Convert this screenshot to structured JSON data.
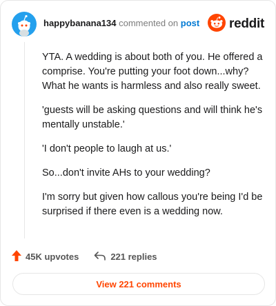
{
  "header": {
    "username": "happybanana134",
    "commented_text": "commented on",
    "post_link": "post",
    "logo_text": "reddit",
    "avatar_icon": "snoo-avatar-icon",
    "logo_icon": "reddit-alien-icon"
  },
  "comment": {
    "paragraphs": [
      "YTA. A wedding is about both of you. He offered a comprise. You're putting your foot down...why? What he wants is harmless and also really sweet.",
      "'guests will be asking questions and will think he's mentally unstable.'",
      "'I don't people to laugh at us.'",
      "So...don't invite AHs to your wedding?",
      "I'm sorry but given how callous you're being I'd be surprised if there even is a wedding now."
    ]
  },
  "actions": {
    "upvotes": "45K upvotes",
    "replies": "221 replies",
    "upvote_icon": "upvote-arrow-icon",
    "reply_icon": "reply-arrow-icon"
  },
  "footer": {
    "view_comments": "View 221 comments"
  },
  "colors": {
    "brand": "#ff4500",
    "link": "#0079d3",
    "avatar_bg": "#24a0ed"
  }
}
